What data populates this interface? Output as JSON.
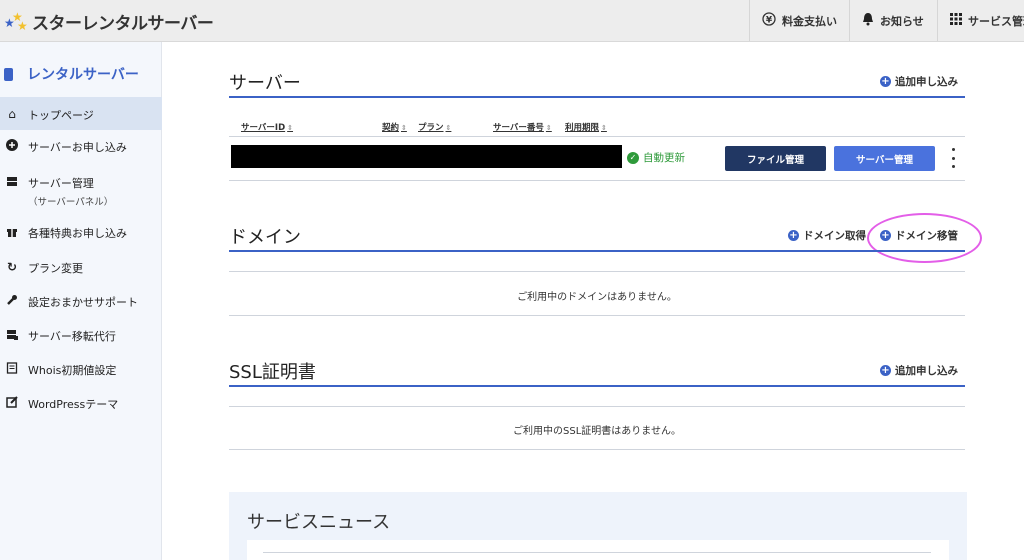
{
  "brand": {
    "name": "スターレンタルサーバー",
    "accent": "#3b62c6",
    "star_colors": [
      "#3b62c6",
      "#f2c12e",
      "#f2c12e"
    ]
  },
  "topnav": [
    {
      "icon": "yen-circle-icon",
      "label": "料金支払い"
    },
    {
      "icon": "bell-icon",
      "label": "お知らせ"
    },
    {
      "icon": "grid-icon",
      "label": "サービス管理"
    }
  ],
  "sidebar": {
    "title": "レンタルサーバー",
    "items": [
      {
        "icon": "home-icon",
        "label": "トップページ",
        "active": true
      },
      {
        "icon": "plus-circle-icon",
        "label": "サーバーお申し込み"
      },
      {
        "icon": "server-icon",
        "label": "サーバー管理",
        "sub": "（サーバーパネル）"
      },
      {
        "icon": "gift-icon",
        "label": "各種特典お申し込み"
      },
      {
        "icon": "refresh-icon",
        "label": "プラン変更"
      },
      {
        "icon": "wrench-icon",
        "label": "設定おまかせサポート"
      },
      {
        "icon": "server-transfer-icon",
        "label": "サーバー移転代行"
      },
      {
        "icon": "form-icon",
        "label": "Whois初期値設定"
      },
      {
        "icon": "edit-icon",
        "label": "WordPressテーマ"
      }
    ]
  },
  "server": {
    "title": "サーバー",
    "add_label": "追加申し込み",
    "columns": [
      "サーバーID",
      "契約",
      "プラン",
      "サーバー番号",
      "利用期限"
    ],
    "row": {
      "status": "自動更新",
      "file_button": "ファイル管理",
      "manage_button": "サーバー管理"
    }
  },
  "domain": {
    "title": "ドメイン",
    "acquire_label": "ドメイン取得",
    "transfer_label": "ドメイン移管",
    "empty": "ご利用中のドメインはありません。"
  },
  "ssl": {
    "title": "SSL証明書",
    "add_label": "追加申し込み",
    "empty": "ご利用中のSSL証明書はありません。"
  },
  "news": {
    "title": "サービスニュース"
  },
  "colors": {
    "button_dark": "#213763",
    "button_primary": "#4a72dd",
    "status_green": "#2e9a3a",
    "highlight": "#e35ee8"
  }
}
